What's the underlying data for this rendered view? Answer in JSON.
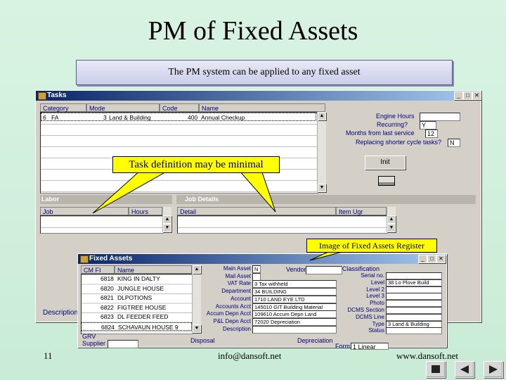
{
  "slide": {
    "title": "PM of Fixed Assets",
    "subtitle": "The PM system can be applied to any fixed asset",
    "callout_task": "Task definition may be minimal",
    "callout_image": "Image of Fixed Assets Register",
    "page_number": "11",
    "email": "info@dansoft.net",
    "website": "www.dansoft.net"
  },
  "tasks_window": {
    "title": "Tasks",
    "columns": [
      "Category",
      "Mode",
      "Code",
      "Name"
    ],
    "row": {
      "category": "6",
      "cat2": "FA",
      "mode": "3",
      "mode_name": "Land & Building",
      "code": "400",
      "name": "Annual Checkup"
    },
    "fields": {
      "engine_hours_label": "Engine Hours",
      "engine_hours_value": "",
      "recurring_label": "Recurring?",
      "recurring_value": "Y",
      "months_label": "Months from last service",
      "months_value": "12",
      "replacing_label": "Replacing shorter cycle tasks?",
      "replacing_value": "N"
    },
    "init_button": "Init",
    "labor_header": "Labor",
    "job_details_header": "Job Details",
    "labor_columns": [
      "Job",
      "Hours"
    ],
    "details_columns": [
      "Detail",
      "Item Ugr"
    ],
    "description_label": "Description"
  },
  "fixed_assets_window": {
    "title": "Fixed Assets",
    "columns": [
      "CM FI",
      "Name"
    ],
    "rows": [
      {
        "code": "6818",
        "name": "KING IN DALTY"
      },
      {
        "code": "6820",
        "name": "JUNGLE HOUSE"
      },
      {
        "code": "6821",
        "name": "DLPOTIONS"
      },
      {
        "code": "6822",
        "name": "FIGTREE HOUSE"
      },
      {
        "code": "6823",
        "name": "DL FEEDER FEED"
      },
      {
        "code": "6824",
        "name": "SCHAVAUN HOUSE 9"
      }
    ],
    "middle_labels": [
      "Main Asset",
      "Mail Asset",
      "VAT Rate",
      "Department",
      "Account",
      "Accounts Acct",
      "Accum Depn Acct",
      "P&L Depn Acct",
      "Description"
    ],
    "middle_values": [
      "N",
      "",
      "3 Tax withheld",
      "34 BUILDING",
      "1710 LAND EYE LTD",
      "145010 GIT Building Material",
      "109610 Accum Depn Land",
      "72020 Depreciation",
      ""
    ],
    "vendor_label": "Vendor",
    "classification_label": "Classification",
    "right_labels": [
      "Serial no.",
      "Level",
      "Level 2",
      "Level 3",
      "Photo",
      "DCMS Section",
      "DCMS Line",
      "Type",
      "Status"
    ],
    "right_values": [
      "",
      "38 Lo Plove Build",
      "",
      "",
      "",
      "",
      "",
      "3 Land & Building",
      ""
    ],
    "grv_label": "GRV",
    "supplier_label": "Supplier",
    "disposal_label": "Disposal",
    "depreciation_label": "Depreciation",
    "form_label": "Form",
    "form_value": "1 Linear"
  },
  "icons": {
    "app": "folder-icon",
    "minimize": "minimize-icon",
    "maximize": "maximize-icon",
    "close": "close-icon",
    "printer": "printer-icon",
    "nav_home": "home-icon",
    "nav_back": "back-arrow-icon",
    "nav_forward": "forward-arrow-icon"
  }
}
